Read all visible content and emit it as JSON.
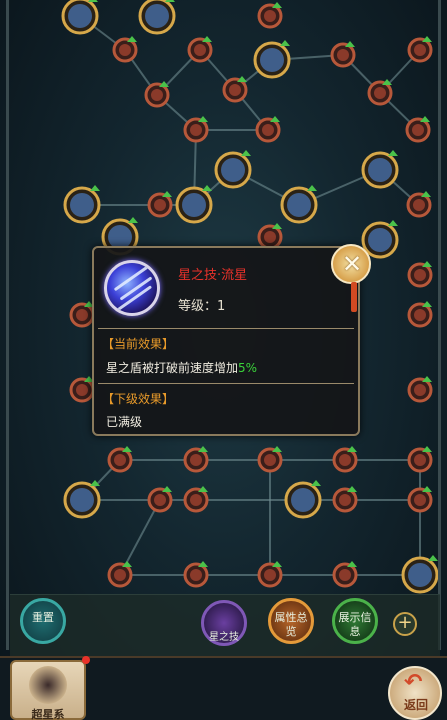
{
  "popup": {
    "skill_name": "星之技·流星",
    "level_label": "等级：",
    "level_value": "1",
    "current_effect_header": "【当前效果】",
    "current_effect_text": "星之盾被打破前速度增加",
    "current_effect_percent": "5%",
    "next_effect_header": "【下级效果】",
    "next_effect_text": "已满级"
  },
  "bottom_bar": {
    "reset_label": "重置",
    "star_skill_label": "星之技",
    "attribute_overview_label": "属性总览",
    "show_info_label": "展示信息",
    "add_label": "+"
  },
  "footer": {
    "star_system_label": "超星系",
    "return_label": "返回"
  },
  "colors": {
    "skill_name": "#e8322a",
    "effect_header": "#e89a2a",
    "percent": "#3ad23a"
  }
}
